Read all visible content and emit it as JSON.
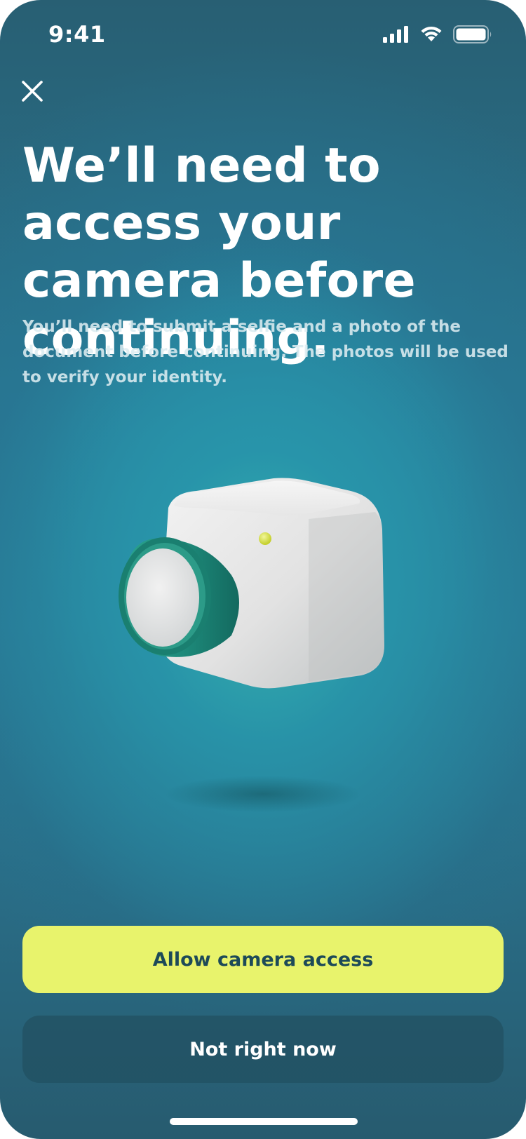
{
  "status_bar": {
    "time": "9:41",
    "icons": [
      "signal-icon",
      "wifi-icon",
      "battery-icon"
    ]
  },
  "header": {
    "close_icon": "close-icon"
  },
  "main": {
    "title": "We’ll need to access your camera before continuing.",
    "subtitle": "You’ll need to submit a selfie and a photo of the document before continuing. The photos will be used to verify your identity.",
    "illustration": "camera-illustration"
  },
  "actions": {
    "primary_label": "Allow camera access",
    "secondary_label": "Not right now"
  },
  "colors": {
    "background_top": "#285f73",
    "background_glow": "#34b2af",
    "primary_button": "#e8f36c",
    "primary_button_text": "#1d4a58",
    "secondary_button": "#225062",
    "camera_lens": "#1f8f7e",
    "camera_body": "#e4e4e4",
    "camera_indicator": "#dfe85a"
  }
}
